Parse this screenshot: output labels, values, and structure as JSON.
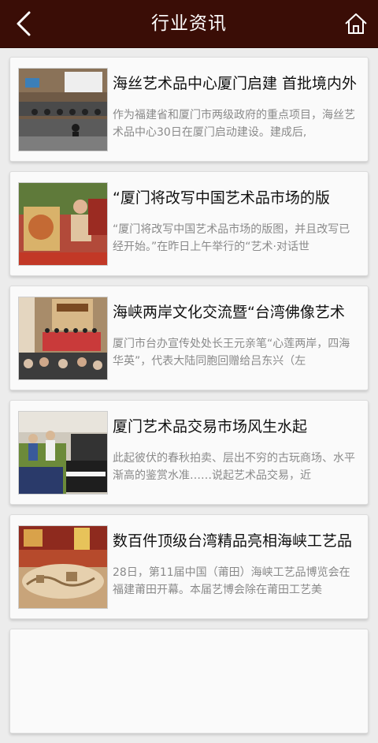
{
  "header": {
    "title": "行业资讯"
  },
  "articles": [
    {
      "title": "海丝艺术品中心厦门启建 首批境内外",
      "summary": "作为福建省和厦门市两级政府的重点项目，海丝艺术品中心30日在厦门启动建设。建成后,"
    },
    {
      "title": "“厦门将改写中国艺术品市场的版",
      "summary": "“厦门将改写中国艺术品市场的版图，并且改写已经开始。”在昨日上午举行的“艺术·对话世"
    },
    {
      "title": "海峡两岸文化交流暨“台湾佛像艺术",
      "summary": "厦门市台办宣传处处长王元亲笔“心莲两岸，四海华英”，代表大陆同胞回赠给吕东兴（左"
    },
    {
      "title": "厦门艺术品交易市场风生水起",
      "summary": "此起彼伏的春秋拍卖、层出不穷的古玩商场、水平渐高的鉴赏水准……说起艺术品交易，近"
    },
    {
      "title": "数百件顶级台湾精品亮相海峡工艺品",
      "summary": "28日，第11届中国（莆田）海峡工艺品博览会在福建莆田开幕。本届艺博会除在莆田工艺美"
    }
  ]
}
